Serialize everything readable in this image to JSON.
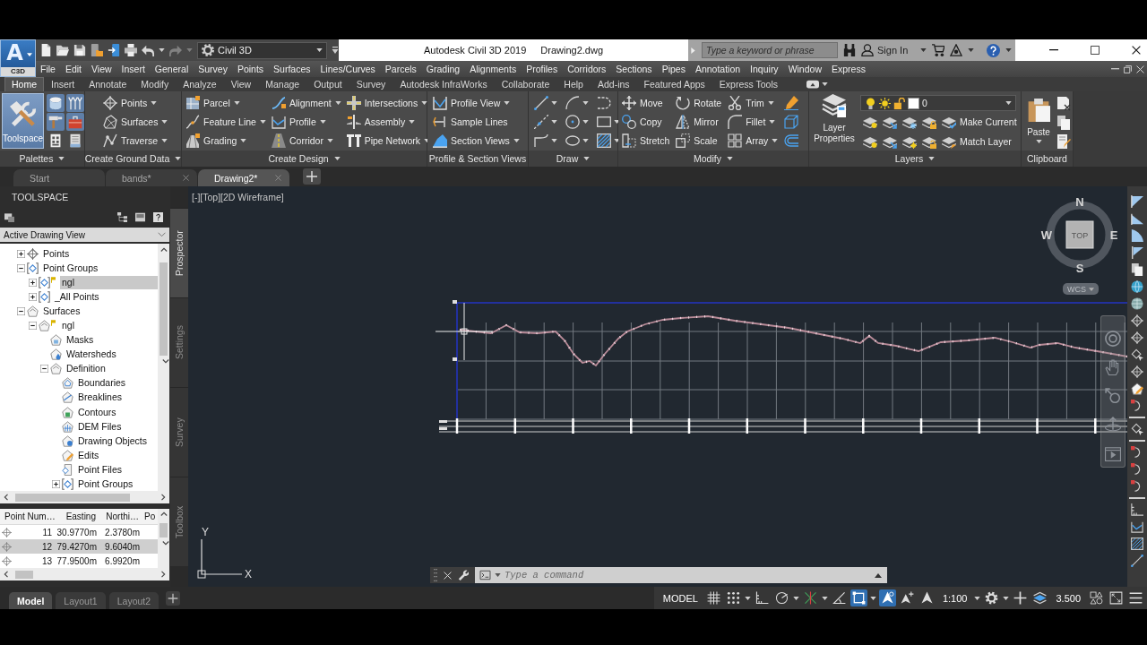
{
  "app_button": {
    "logo": "A",
    "label": "C3D"
  },
  "quick_access": {
    "tools": [
      {
        "dropdown": false,
        "disabled": false
      },
      {
        "dropdown": false,
        "disabled": false
      },
      {
        "dropdown": false,
        "disabled": false
      },
      {
        "dropdown": false,
        "disabled": false
      },
      {
        "dropdown": false,
        "disabled": false
      },
      {
        "dropdown": false,
        "disabled": false
      },
      {
        "dropdown": true,
        "disabled": false
      },
      {
        "dropdown": true,
        "disabled": true
      }
    ],
    "workspace": "Civil 3D"
  },
  "window": {
    "title": "Autodesk Civil 3D 2019",
    "document": "Drawing2.dwg"
  },
  "search": {
    "placeholder": "Type a keyword or phrase"
  },
  "account": {
    "label": "Sign In"
  },
  "menu_bar": [
    "File",
    "Edit",
    "View",
    "Insert",
    "General",
    "Survey",
    "Points",
    "Surfaces",
    "Lines/Curves",
    "Parcels",
    "Grading",
    "Alignments",
    "Profiles",
    "Corridors",
    "Sections",
    "Pipes",
    "Annotation",
    "Inquiry",
    "Window",
    "Express"
  ],
  "ribbon_tabs": [
    {
      "label": "Home",
      "selected": true
    },
    {
      "label": "Insert",
      "selected": false
    },
    {
      "label": "Annotate",
      "selected": false
    },
    {
      "label": "Modify",
      "selected": false
    },
    {
      "label": "Analyze",
      "selected": false
    },
    {
      "label": "View",
      "selected": false
    },
    {
      "label": "Manage",
      "selected": false
    },
    {
      "label": "Output",
      "selected": false
    },
    {
      "label": "Survey",
      "selected": false
    },
    {
      "label": "Autodesk InfraWorks",
      "selected": false
    },
    {
      "label": "Collaborate",
      "selected": false
    },
    {
      "label": "Help",
      "selected": false
    },
    {
      "label": "Add-ins",
      "selected": false
    },
    {
      "label": "Featured Apps",
      "selected": false
    },
    {
      "label": "Express Tools",
      "selected": false
    }
  ],
  "ribbon_panels": [
    {
      "kind": "palettes",
      "title": "Palettes",
      "menu": true,
      "big": {
        "label": "Toolspace",
        "selected": true
      },
      "tools": [
        {
          "selected": true
        },
        {
          "selected": true
        },
        {
          "selected": true
        },
        {
          "selected": true
        },
        {
          "selected": false
        },
        {
          "selected": false
        }
      ]
    },
    {
      "kind": "columns",
      "title": "Create Ground Data",
      "menu": true,
      "columns": [
        [
          {
            "label": "Points",
            "dropdown": true
          },
          {
            "label": "Surfaces",
            "dropdown": true
          },
          {
            "label": "Traverse",
            "dropdown": true
          }
        ]
      ]
    },
    {
      "kind": "columns",
      "title": "Create Design",
      "menu": true,
      "columns": [
        [
          {
            "label": "Parcel",
            "dropdown": true
          },
          {
            "label": "Feature Line",
            "dropdown": true
          },
          {
            "label": "Grading",
            "dropdown": true
          }
        ],
        [
          {
            "label": "Alignment",
            "dropdown": true
          },
          {
            "label": "Profile",
            "dropdown": true
          },
          {
            "label": "Corridor",
            "dropdown": true
          }
        ],
        [
          {
            "label": "Intersections",
            "dropdown": true
          },
          {
            "label": "Assembly",
            "dropdown": true
          },
          {
            "label": "Pipe Network",
            "dropdown": true
          }
        ]
      ]
    },
    {
      "kind": "columns",
      "title": "Profile & Section Views",
      "menu": false,
      "columns": [
        [
          {
            "label": "Profile View",
            "dropdown": true
          },
          {
            "label": "Sample Lines",
            "dropdown": false
          },
          {
            "label": "Section Views",
            "dropdown": true
          }
        ]
      ]
    },
    {
      "kind": "columns",
      "title": "Draw",
      "menu": true,
      "columns": [
        [
          {
            "dropdown": true
          },
          {
            "dropdown": true
          },
          {
            "dropdown": true
          }
        ],
        [
          {
            "dropdown": true
          },
          {
            "dropdown": true
          },
          {
            "dropdown": true
          }
        ],
        [
          {
            "dropdown": false
          },
          {
            "dropdown": true
          },
          {
            "dropdown": true
          }
        ]
      ]
    },
    {
      "kind": "columns",
      "title": "Modify",
      "menu": true,
      "columns": [
        [
          {
            "label": "Move",
            "dropdown": false
          },
          {
            "label": "Copy",
            "dropdown": false
          },
          {
            "label": "Stretch",
            "dropdown": false
          }
        ],
        [
          {
            "label": "Rotate",
            "dropdown": false
          },
          {
            "label": "Mirror",
            "dropdown": false
          },
          {
            "label": "Scale",
            "dropdown": false
          }
        ],
        [
          {
            "label": "Trim",
            "dropdown": true
          },
          {
            "label": "Fillet",
            "dropdown": true
          },
          {
            "label": "Array",
            "dropdown": true
          }
        ],
        [
          {
            "dropdown": false
          },
          {
            "dropdown": false
          },
          {
            "dropdown": false
          }
        ]
      ]
    },
    {
      "kind": "layers",
      "title": "Layers",
      "menu": true,
      "big": {
        "label": "Layer Properties"
      },
      "current_layer": "0",
      "actions": [
        {
          "label": "Make Current"
        },
        {
          "label": "Match Layer"
        }
      ]
    },
    {
      "kind": "clipboard",
      "title": "Clipboard",
      "menu": false,
      "big": {
        "label": "Paste",
        "dropdown": true
      }
    }
  ],
  "document_tabs": [
    {
      "label": "Start",
      "selected": false,
      "closable": false
    },
    {
      "label": "bands*",
      "selected": false,
      "closable": true
    },
    {
      "label": "Drawing2*",
      "selected": true,
      "closable": true
    }
  ],
  "toolspace": {
    "title": "TOOLSPACE",
    "view": "Active Drawing View",
    "tree": [
      {
        "label": "Points",
        "kind": "points",
        "expanded": false,
        "selected": false,
        "flag": false
      },
      {
        "label": "Point Groups",
        "kind": "point-groups",
        "expanded": true,
        "selected": false,
        "flag": false,
        "children": [
          {
            "label": "ngl",
            "kind": "point-group",
            "expanded": false,
            "selected": true,
            "flag": true
          },
          {
            "label": "_All Points",
            "kind": "point-group",
            "expanded": false,
            "selected": false,
            "flag": false
          }
        ]
      },
      {
        "label": "Surfaces",
        "kind": "surfaces",
        "expanded": true,
        "selected": false,
        "flag": false,
        "children": [
          {
            "label": "ngl",
            "kind": "surface",
            "expanded": true,
            "selected": false,
            "flag": true,
            "children": [
              {
                "label": "Masks",
                "kind": "masks",
                "selected": false,
                "flag": false
              },
              {
                "label": "Watersheds",
                "kind": "watersheds",
                "selected": false,
                "flag": false
              },
              {
                "label": "Definition",
                "kind": "definition",
                "expanded": true,
                "selected": false,
                "flag": false,
                "children": [
                  {
                    "label": "Boundaries",
                    "kind": "boundaries",
                    "selected": false,
                    "flag": false
                  },
                  {
                    "label": "Breaklines",
                    "kind": "breaklines",
                    "selected": false,
                    "flag": false
                  },
                  {
                    "label": "Contours",
                    "kind": "contours",
                    "selected": false,
                    "flag": false
                  },
                  {
                    "label": "DEM Files",
                    "kind": "dem",
                    "selected": false,
                    "flag": false
                  },
                  {
                    "label": "Drawing Objects",
                    "kind": "drawing-objects",
                    "selected": false,
                    "flag": false
                  },
                  {
                    "label": "Edits",
                    "kind": "edits",
                    "selected": false,
                    "flag": false
                  },
                  {
                    "label": "Point Files",
                    "kind": "point-files",
                    "selected": false,
                    "flag": false
                  },
                  {
                    "label": "Point Groups",
                    "kind": "point-groups",
                    "expanded": false,
                    "selected": false,
                    "flag": false
                  }
                ]
              }
            ]
          }
        ]
      }
    ],
    "table": {
      "columns": [
        "Point Num…",
        "Easting",
        "Northi…",
        "Po"
      ],
      "rows": [
        {
          "cells": [
            "11",
            "30.9770m",
            "2.3780m"
          ],
          "selected": false
        },
        {
          "cells": [
            "12",
            "79.4270m",
            "9.6040m"
          ],
          "selected": true
        },
        {
          "cells": [
            "13",
            "77.9500m",
            "6.9920m"
          ],
          "selected": false
        }
      ]
    },
    "side_tabs": [
      {
        "label": "Prospector",
        "selected": true
      },
      {
        "label": "Settings",
        "selected": false
      },
      {
        "label": "Survey",
        "selected": false
      },
      {
        "label": "Toolbox",
        "selected": false
      }
    ]
  },
  "viewport": {
    "controls": [
      "[-]",
      "[Top]",
      "[2D Wireframe]"
    ],
    "viewcube": {
      "face": "TOP",
      "north": "N",
      "east": "E",
      "south": "S",
      "west": "W",
      "coordinate_system": "WCS"
    },
    "ucs": {
      "x_label": "X",
      "y_label": "Y"
    }
  },
  "command_line": {
    "placeholder": "Type a command"
  },
  "layout_tabs": [
    {
      "label": "Model",
      "selected": true
    },
    {
      "label": "Layout1",
      "selected": false
    },
    {
      "label": "Layout2",
      "selected": false
    }
  ],
  "status_bar": {
    "items": [
      {
        "kind": "label",
        "label": "MODEL",
        "dropdown": false
      },
      {
        "kind": "tool",
        "on": false,
        "dropdown": false
      },
      {
        "kind": "tool",
        "on": false,
        "dropdown": true
      },
      {
        "kind": "tool",
        "on": false,
        "dropdown": false
      },
      {
        "kind": "tool",
        "on": false,
        "dropdown": true
      },
      {
        "kind": "tool",
        "on": false,
        "dropdown": true
      },
      {
        "kind": "tool",
        "on": false,
        "dropdown": false
      },
      {
        "kind": "tool",
        "on": true,
        "dropdown": true
      },
      {
        "kind": "tool",
        "on": true,
        "dropdown": false
      },
      {
        "kind": "tool",
        "on": false,
        "dropdown": false
      },
      {
        "kind": "tool",
        "on": false,
        "dropdown": false
      },
      {
        "kind": "label",
        "label": "1:100",
        "dropdown": true
      },
      {
        "kind": "tool",
        "on": false,
        "dropdown": true
      },
      {
        "kind": "tool",
        "on": false,
        "dropdown": false
      },
      {
        "kind": "tool",
        "on": false,
        "dropdown": false
      },
      {
        "kind": "label",
        "label": "3.500",
        "dropdown": false
      },
      {
        "kind": "tool",
        "on": false,
        "dropdown": false
      },
      {
        "kind": "tool",
        "on": false,
        "dropdown": false
      },
      {
        "kind": "tool",
        "on": false,
        "dropdown": false
      }
    ]
  }
}
